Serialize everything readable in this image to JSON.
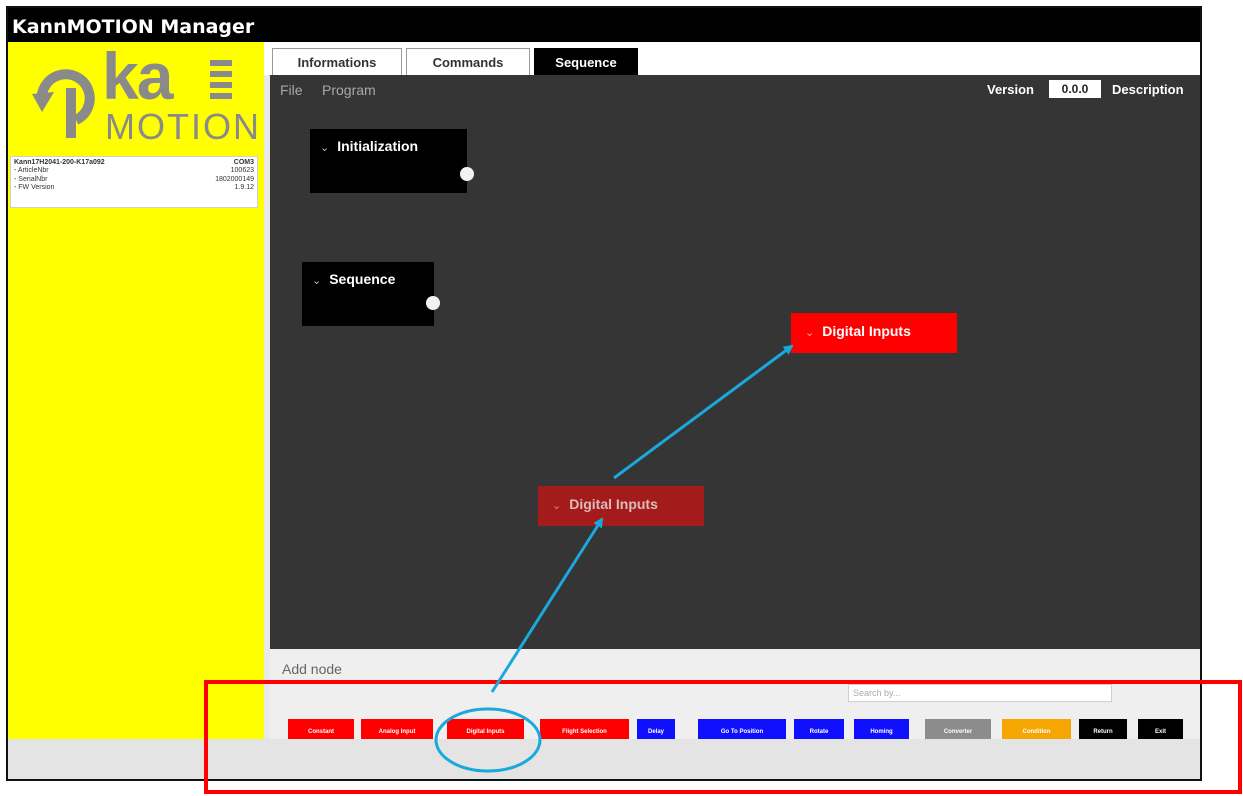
{
  "window": {
    "title": "KannMOTION Manager"
  },
  "logo": {
    "text_top": "ka",
    "text_bottom": "MOTION"
  },
  "device": {
    "name": "Kann17H2041-200-K17a092",
    "port": "COM3",
    "rows": [
      {
        "label": "- ArticleNbr",
        "value": "100623"
      },
      {
        "label": "- SerialNbr",
        "value": "1802000149"
      },
      {
        "label": "- FW Version",
        "value": "1.9.12"
      }
    ]
  },
  "tabs": [
    {
      "label": "Informations",
      "active": false
    },
    {
      "label": "Commands",
      "active": false
    },
    {
      "label": "Sequence",
      "active": true
    }
  ],
  "menu": {
    "file": "File",
    "program": "Program",
    "version_label": "Version",
    "version_value": "0.0.0",
    "description_label": "Description"
  },
  "nodes": {
    "initialization": "Initialization",
    "sequence": "Sequence",
    "digital_inputs_dragged": "Digital Inputs",
    "digital_inputs_placed": "Digital Inputs"
  },
  "add_node": {
    "label": "Add node",
    "search_placeholder": "Search by..."
  },
  "palette": [
    {
      "label": "Constant",
      "color": "#ff0000"
    },
    {
      "label": "Analog Input",
      "color": "#ff0000"
    },
    {
      "label": "Digital Inputs",
      "color": "#ff0000"
    },
    {
      "label": "Flight Selection",
      "color": "#ff0000"
    },
    {
      "label": "Delay",
      "color": "#1010ff"
    },
    {
      "label": "Go To Position",
      "color": "#1010ff"
    },
    {
      "label": "Rotate",
      "color": "#1010ff"
    },
    {
      "label": "Homing",
      "color": "#1010ff"
    },
    {
      "label": "Converter",
      "color": "#8c8c8c"
    },
    {
      "label": "Condition",
      "color": "#f6a600"
    },
    {
      "label": "Return",
      "color": "#000000"
    },
    {
      "label": "Exit",
      "color": "#000000"
    }
  ],
  "colors": {
    "title_bar": "#000000",
    "sidebar": "#ffff00",
    "canvas": "#353535",
    "annotation_box": "#ff0000",
    "annotation_arrow": "#1aa9dd"
  }
}
